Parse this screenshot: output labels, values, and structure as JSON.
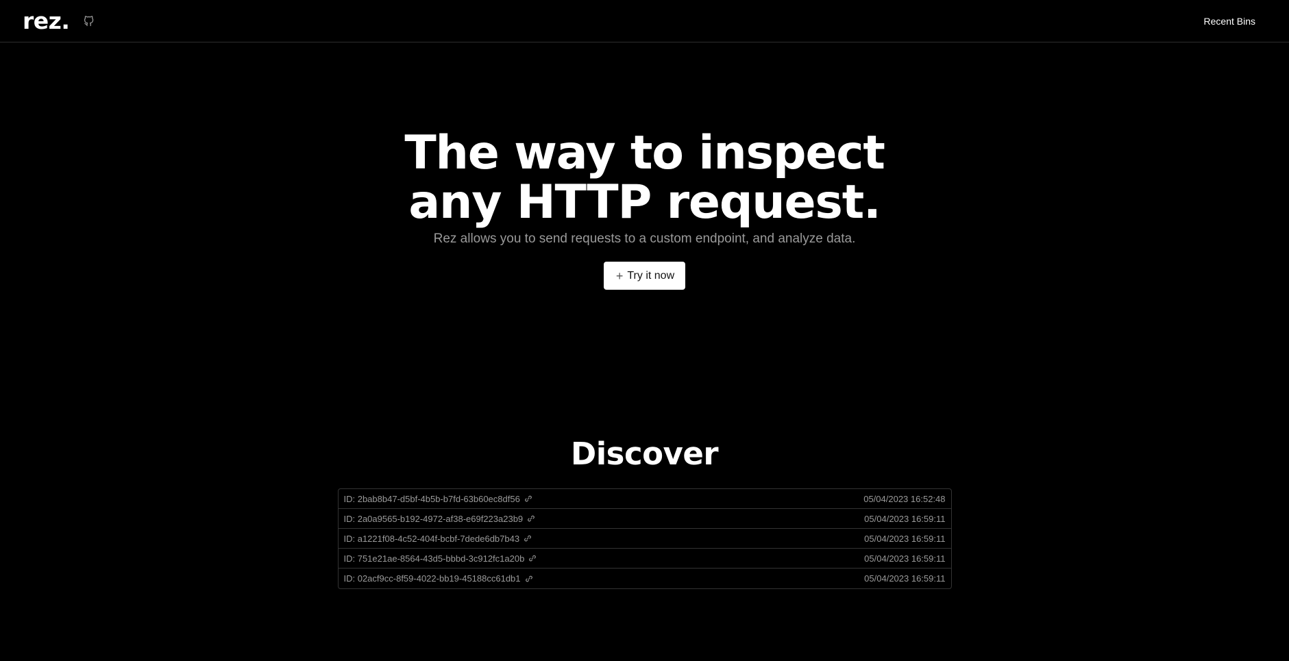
{
  "header": {
    "logo": "rez.",
    "github_icon": "github-icon",
    "recent_bins_label": "Recent Bins"
  },
  "hero": {
    "title": "The way to inspect any HTTP request.",
    "subtitle": "Rez allows you to send requests to a custom endpoint, and analyze data.",
    "cta_icon": "+",
    "cta_label": "Try it now"
  },
  "discover": {
    "title": "Discover",
    "bins": [
      {
        "id": "ID: 2bab8b47-d5bf-4b5b-b7fd-63b60ec8df56",
        "timestamp": "05/04/2023 16:52:48"
      },
      {
        "id": "ID: 2a0a9565-b192-4972-af38-e69f223a23b9",
        "timestamp": "05/04/2023 16:59:11"
      },
      {
        "id": "ID: a1221f08-4c52-404f-bcbf-7dede6db7b43",
        "timestamp": "05/04/2023 16:59:11"
      },
      {
        "id": "ID: 751e21ae-8564-43d5-bbbd-3c912fc1a20b",
        "timestamp": "05/04/2023 16:59:11"
      },
      {
        "id": "ID: 02acf9cc-8f59-4022-bb19-45188cc61db1",
        "timestamp": "05/04/2023 16:59:11"
      }
    ]
  },
  "colors": {
    "background": "#000000",
    "text": "#ffffff",
    "muted": "#9a9a9a",
    "border": "#333333",
    "button_bg": "#ffffff"
  }
}
